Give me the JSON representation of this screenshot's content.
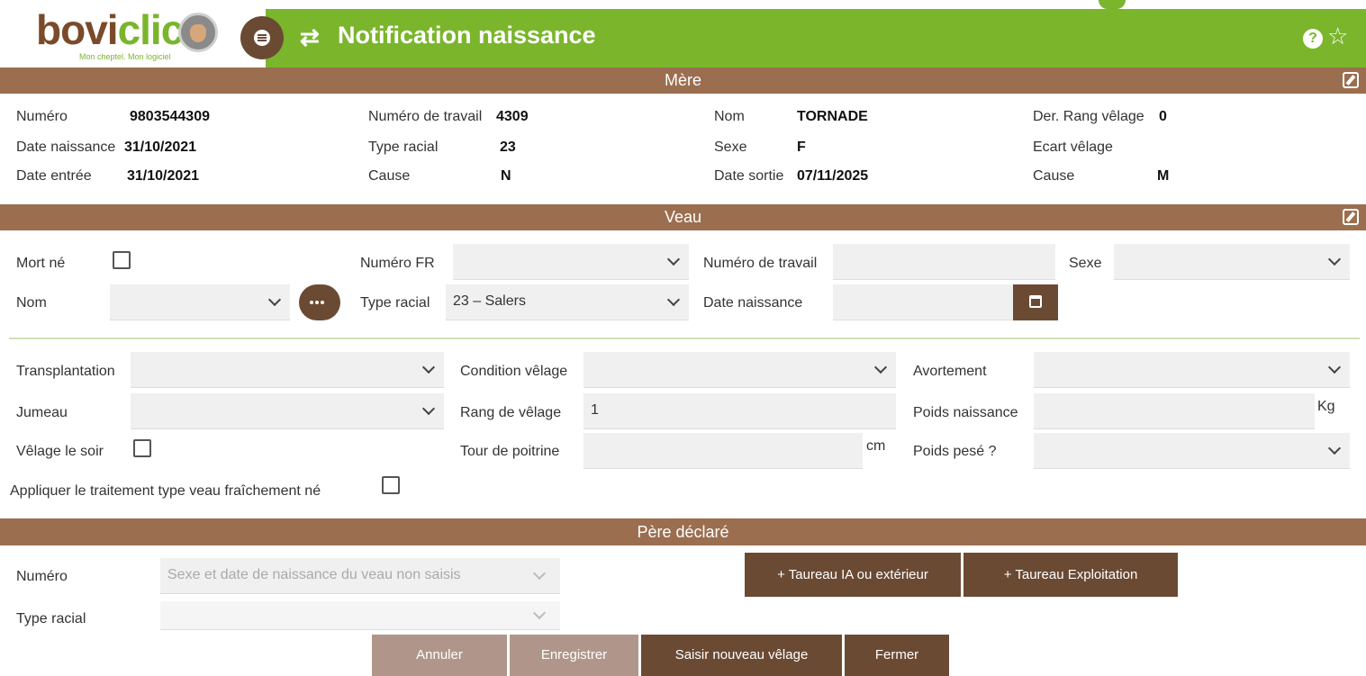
{
  "header": {
    "logo_text_part1": "bovi",
    "logo_text_part2": "clic",
    "logo_tagline": "Mon cheptel. Mon logiciel",
    "title": "Notification naissance",
    "help_glyph": "?",
    "star_glyph": "☆",
    "swap_glyph": "⇄"
  },
  "mere": {
    "section_title": "Mère",
    "numero_label": "Numéro",
    "numero_value": "9803544309",
    "date_naissance_label": "Date naissance",
    "date_naissance_value": "31/10/2021",
    "date_entree_label": "Date entrée",
    "date_entree_value": "31/10/2021",
    "numero_travail_label": "Numéro de travail",
    "numero_travail_value": "4309",
    "type_racial_label": "Type racial",
    "type_racial_value": "23",
    "cause_label": "Cause",
    "cause_value": "N",
    "nom_label": "Nom",
    "nom_value": "TORNADE",
    "sexe_label": "Sexe",
    "sexe_value": "F",
    "date_sortie_label": "Date sortie",
    "date_sortie_value": "07/11/2025",
    "der_rang_label": "Der. Rang vêlage",
    "der_rang_value": "0",
    "ecart_label": "Ecart vêlage",
    "ecart_value": "",
    "cause2_label": "Cause",
    "cause2_value": "M"
  },
  "veau": {
    "section_title": "Veau",
    "mort_ne_label": "Mort né",
    "numero_fr_label": "Numéro FR",
    "numero_fr_value": "",
    "numero_travail_label": "Numéro de travail",
    "numero_travail_value": "",
    "sexe_label": "Sexe",
    "sexe_value": "",
    "nom_label": "Nom",
    "nom_value": "",
    "type_racial_label": "Type racial",
    "type_racial_value": "23 – Salers",
    "date_naissance_label": "Date naissance",
    "date_naissance_value": "",
    "transplantation_label": "Transplantation",
    "transplantation_value": "",
    "condition_label": "Condition vêlage",
    "condition_value": "",
    "avortement_label": "Avortement",
    "avortement_value": "",
    "jumeau_label": "Jumeau",
    "jumeau_value": "",
    "rang_label": "Rang de vêlage",
    "rang_value": "1",
    "poids_naissance_label": "Poids naissance",
    "poids_naissance_value": "",
    "poids_unit": "Kg",
    "velage_soir_label": "Vêlage le soir",
    "tour_poitrine_label": "Tour de poitrine",
    "tour_poitrine_value": "",
    "tour_unit": "cm",
    "poids_pese_label": "Poids pesé ?",
    "poids_pese_value": "",
    "traitement_label": "Appliquer le traitement type veau fraîchement né"
  },
  "pere": {
    "section_title": "Père déclaré",
    "numero_label": "Numéro",
    "numero_placeholder": "Sexe et date de naissance du veau non saisis",
    "type_racial_label": "Type racial",
    "type_racial_value": "",
    "btn_taureau_ia": "+ Taureau IA ou extérieur",
    "btn_taureau_exploitation": "+ Taureau Exploitation"
  },
  "actions": {
    "annuler": "Annuler",
    "enregistrer": "Enregistrer",
    "saisir": "Saisir nouveau vêlage",
    "fermer": "Fermer"
  },
  "colors": {
    "green": "#7ab52c",
    "brown_dark": "#6b4a33",
    "brown_section": "#9b6e4f"
  }
}
